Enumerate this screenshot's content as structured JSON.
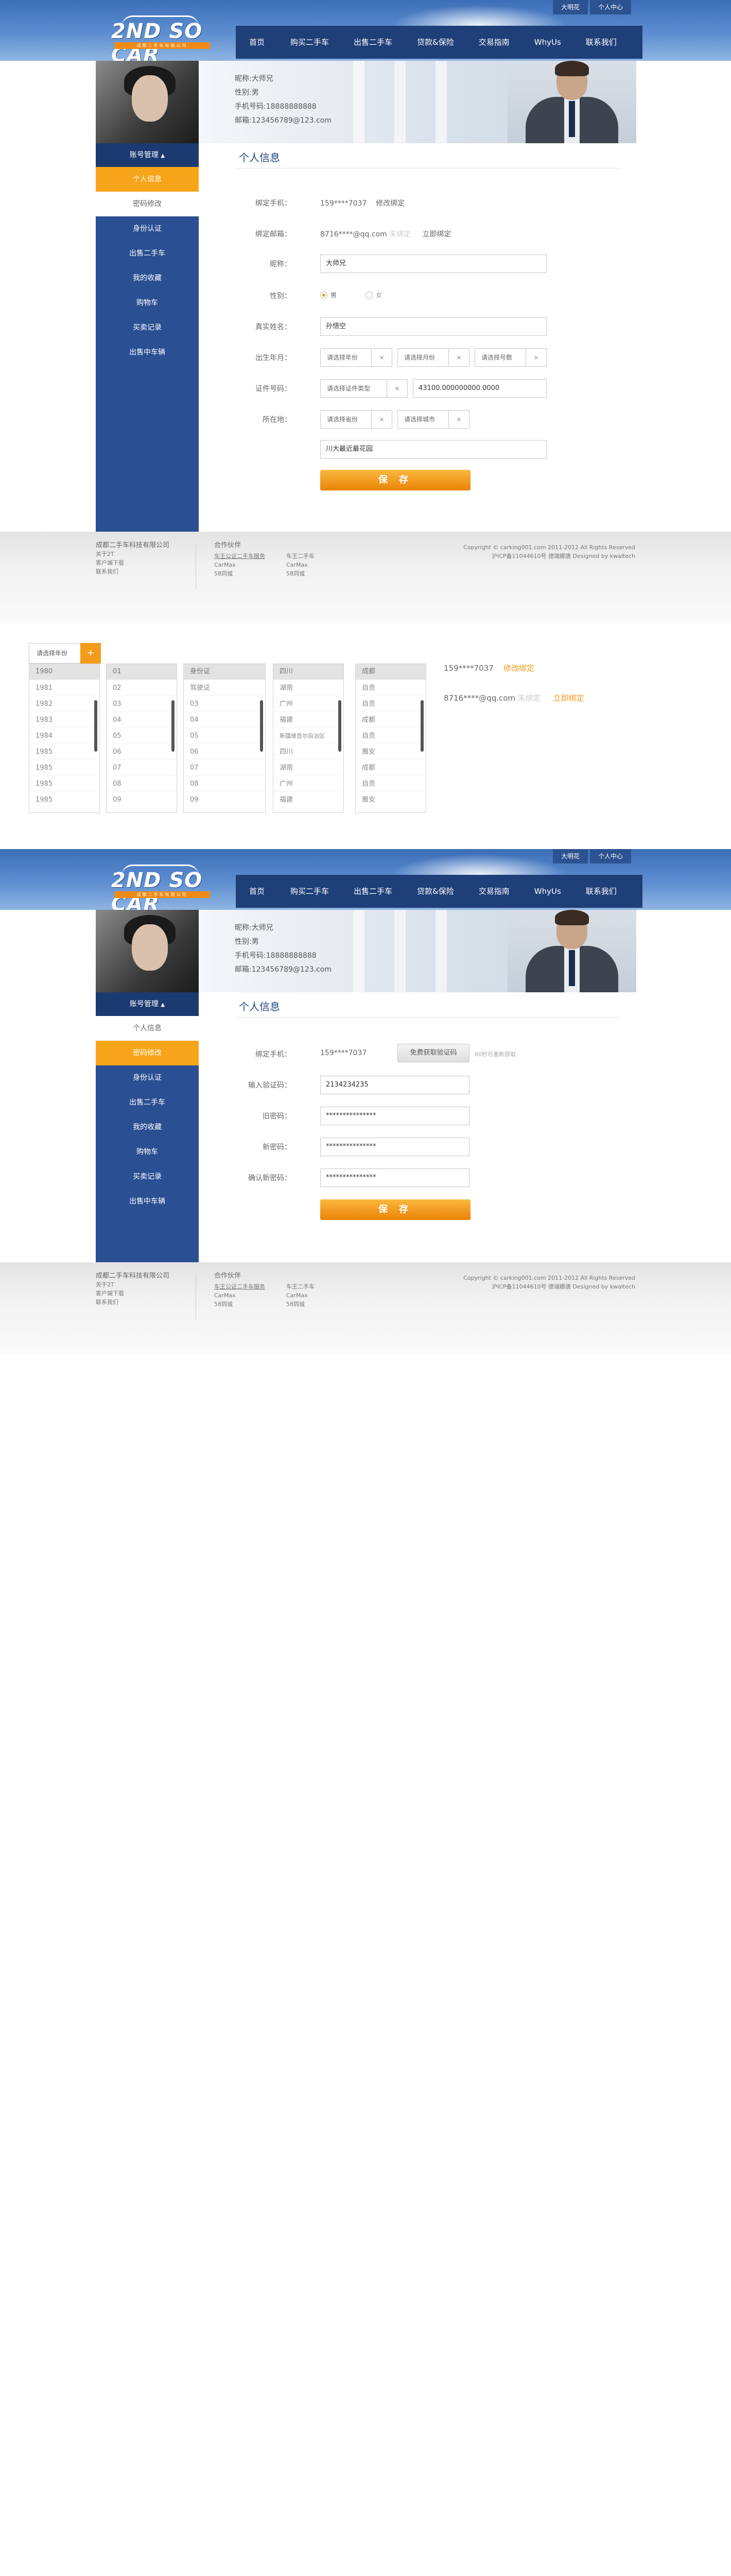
{
  "header": {
    "logo_text": "2ND SO CAR",
    "logo_subtext": "成都二手车有限公司",
    "top_links": [
      "大明花",
      "个人中心"
    ],
    "nav": [
      "首页",
      "购买二手车",
      "出售二手车",
      "贷款&保险",
      "交易指南",
      "WhyUs",
      "联系我们"
    ]
  },
  "profile": {
    "name": "昵称:大师兄",
    "gender": "性别:男",
    "phone": "手机号码:18888888888",
    "email": "邮箱:123456789@123.com"
  },
  "sidebar": {
    "title": "账号管理",
    "toggle": "▲",
    "items": [
      "个人信息",
      "密码修改",
      "身份认证",
      "出售二手车",
      "我的收藏",
      "购物车",
      "买卖记录",
      "出售中车辆"
    ]
  },
  "personal": {
    "title": "个人信息",
    "bind_phone_label": "绑定手机：",
    "bind_phone_value": "159****7037",
    "bind_phone_action": "修改绑定",
    "bind_email_label": "绑定邮箱：",
    "bind_email_value": "8716****@qq.com",
    "bind_email_status": "未绑定",
    "bind_email_action": "立即绑定",
    "nickname_label": "昵称：",
    "nickname_value": "大师兄",
    "gender_label": "性别：",
    "gender_male": "男",
    "gender_female": "女",
    "realname_label": "真实姓名：",
    "realname_value": "孙悟空",
    "birth_label": "出生年月：",
    "birth_year": "请选择年份",
    "birth_month": "请选择月份",
    "birth_day": "请选择号数",
    "id_label": "证件号码：",
    "id_type": "请选择证件类型",
    "id_value": "43100.000000000.0000",
    "location_label": "所在地：",
    "province": "请选择省份",
    "city": "请选择城市",
    "address_value": "川大最近最花园",
    "save_label": "保  存"
  },
  "footer": {
    "company": "成都二手车科技有限公司",
    "company_links": [
      "关于2T",
      "客户端下载",
      "联系我们"
    ],
    "partner_title": "合作伙伴",
    "partners_col1": [
      "车王公证二手车服务",
      "CarMax",
      "58同城"
    ],
    "partners_col2": [
      "车王二手车",
      "CarMax",
      "58同城"
    ],
    "copyright": "Copyright © carking001.com 2011-2012 All Rights Reserved",
    "icp": "沪ICP备11044610号 德瑞娜唐 Designed by kwaltech"
  },
  "picker": {
    "button_label": "请选择年份",
    "plus": "+",
    "years": [
      "1980",
      "1981",
      "1982",
      "1983",
      "1984",
      "1985",
      "1985",
      "1985",
      "1985"
    ],
    "days": [
      "01",
      "02",
      "03",
      "04",
      "05",
      "06",
      "07",
      "08",
      "09"
    ],
    "id_types": [
      "身份证",
      "驾驶证",
      "03",
      "04",
      "05",
      "06",
      "07",
      "08",
      "09"
    ],
    "provinces": [
      "四川",
      "湖南",
      "广州",
      "福建",
      "新疆维吾尔自治区",
      "四川",
      "湖南",
      "广州",
      "福建"
    ],
    "cities": [
      "成都",
      "自贡",
      "自贡",
      "成都",
      "自贡",
      "雅安",
      "成都",
      "自贡",
      "雅安"
    ],
    "phone_value": "159****7037",
    "phone_action": "修改绑定",
    "email_value": "8716****@qq.com",
    "email_status": "未绑定",
    "email_action": "立即绑定"
  },
  "password": {
    "title": "个人信息",
    "bind_phone_label": "绑定手机：",
    "bind_phone_value": "159****7037",
    "code_button": "免费获取验证码",
    "code_hint": "60秒可重新获取",
    "code_label": "输入验证码：",
    "code_value": "2134234235",
    "old_label": "旧密码：",
    "old_value": "***************",
    "new_label": "新密码：",
    "new_value": "***************",
    "confirm_label": "确认新密码：",
    "confirm_value": "***************",
    "save_label": "保  存"
  }
}
